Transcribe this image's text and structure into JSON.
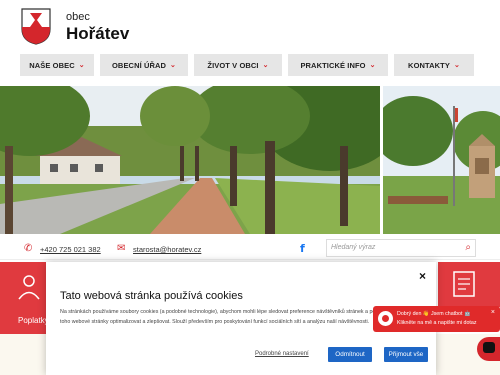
{
  "header": {
    "label": "obec",
    "name": "Hořátev"
  },
  "nav": {
    "items": [
      {
        "label": "NAŠE OBEC"
      },
      {
        "label": "OBECNÍ ÚŘAD"
      },
      {
        "label": "ŽIVOT V OBCI"
      },
      {
        "label": "PRAKTICKÉ INFO"
      },
      {
        "label": "KONTAKTY"
      }
    ],
    "chevron": "⌄"
  },
  "contact": {
    "phone": "+420 725 021 382",
    "email": "starosta@horatev.cz",
    "facebook": "f"
  },
  "search": {
    "placeholder": "Hledaný výraz"
  },
  "tiles": {
    "left_label": "Poplatky"
  },
  "cookie": {
    "close": "×",
    "title": "Tato webová stránka používá cookies",
    "text": "Na stránkách používáme soubory cookies (a podobné technologie), abychom mohli lépe sledovat preference návštěvníků stránek a podle toho webové stránky optimalizovat a zlepšovat. Slouží především pro poskytování funkcí sociálních sítí a analýzu naší návštěvnosti.",
    "settings": "Podrobné nastavení",
    "decline": "Odmítnout",
    "accept": "Přijmout vše"
  },
  "chat": {
    "line1": "Dobrý den 👋 Jsem chatbot 🤖",
    "line2": "Klikněte na mě a napište mi dotaz",
    "close": "×"
  },
  "colors": {
    "brand_red": "#d4262c",
    "button_blue": "#1e66c5",
    "nav_bg": "#e6e6e6"
  }
}
